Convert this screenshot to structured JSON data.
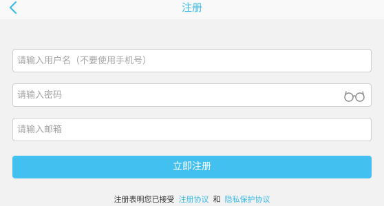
{
  "header": {
    "title": "注册",
    "back_icon": "chevron-left-icon"
  },
  "form": {
    "username_placeholder": "请输入用户名（不要使用手机号）",
    "password_placeholder": "请输入密码",
    "password_toggle_icon": "glasses-icon",
    "email_placeholder": "请输入邮箱",
    "submit_label": "立即注册"
  },
  "agreement": {
    "prefix": "注册表明您已接受",
    "terms_link": "注册协议",
    "conjunction": "和",
    "privacy_link": "隐私保护协议"
  },
  "colors": {
    "accent": "#3cbbe8",
    "button": "#42c0f0",
    "background": "#f2f2f2"
  }
}
